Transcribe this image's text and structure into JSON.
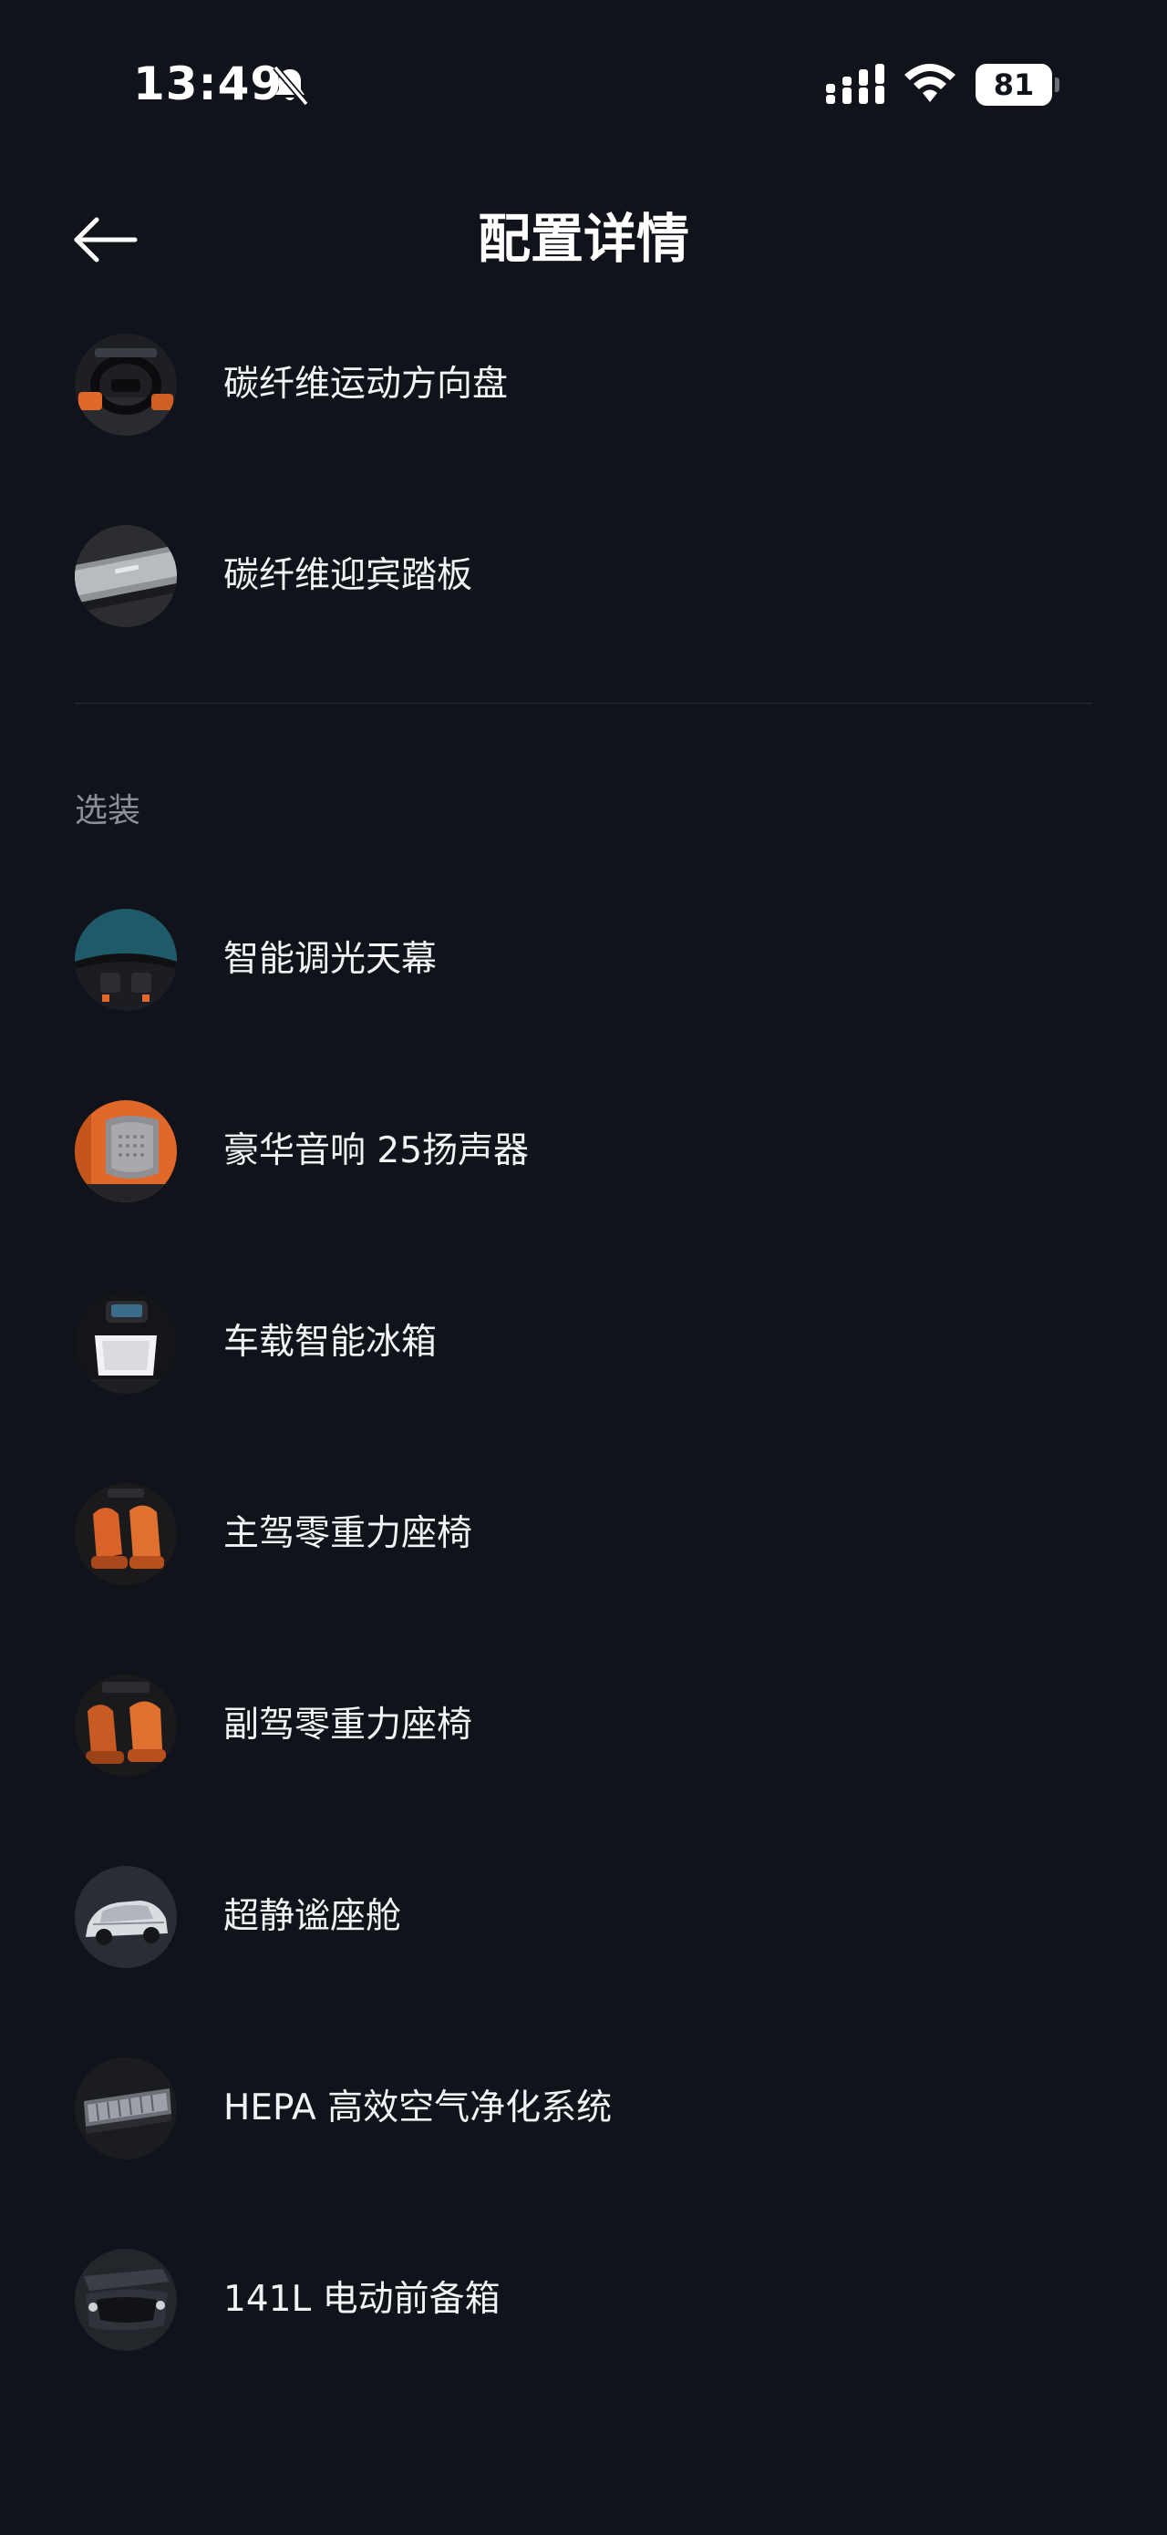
{
  "status_bar": {
    "time": "13:49",
    "battery": "81"
  },
  "nav": {
    "title": "配置详情"
  },
  "standard_items": [
    {
      "label": "碳纤维运动方向盘",
      "icon": "steering-wheel-thumbnail"
    },
    {
      "label": "碳纤维迎宾踏板",
      "icon": "door-sill-thumbnail"
    }
  ],
  "optional_section": {
    "title": "选装",
    "items": [
      {
        "label": "智能调光天幕",
        "icon": "sunroof-thumbnail"
      },
      {
        "label": "豪华音响 25扬声器",
        "icon": "speaker-thumbnail"
      },
      {
        "label": "车载智能冰箱",
        "icon": "fridge-thumbnail"
      },
      {
        "label": "主驾零重力座椅",
        "icon": "driver-seat-thumbnail"
      },
      {
        "label": "副驾零重力座椅",
        "icon": "passenger-seat-thumbnail"
      },
      {
        "label": "超静谧座舱",
        "icon": "quiet-cabin-thumbnail"
      },
      {
        "label": "HEPA 高效空气净化系统",
        "icon": "air-filter-thumbnail"
      },
      {
        "label": "141L 电动前备箱",
        "icon": "front-trunk-thumbnail"
      }
    ]
  },
  "colors": {
    "background": "#11131a",
    "accent_orange": "#e0682a",
    "secondary_text": "#8b8f98"
  }
}
